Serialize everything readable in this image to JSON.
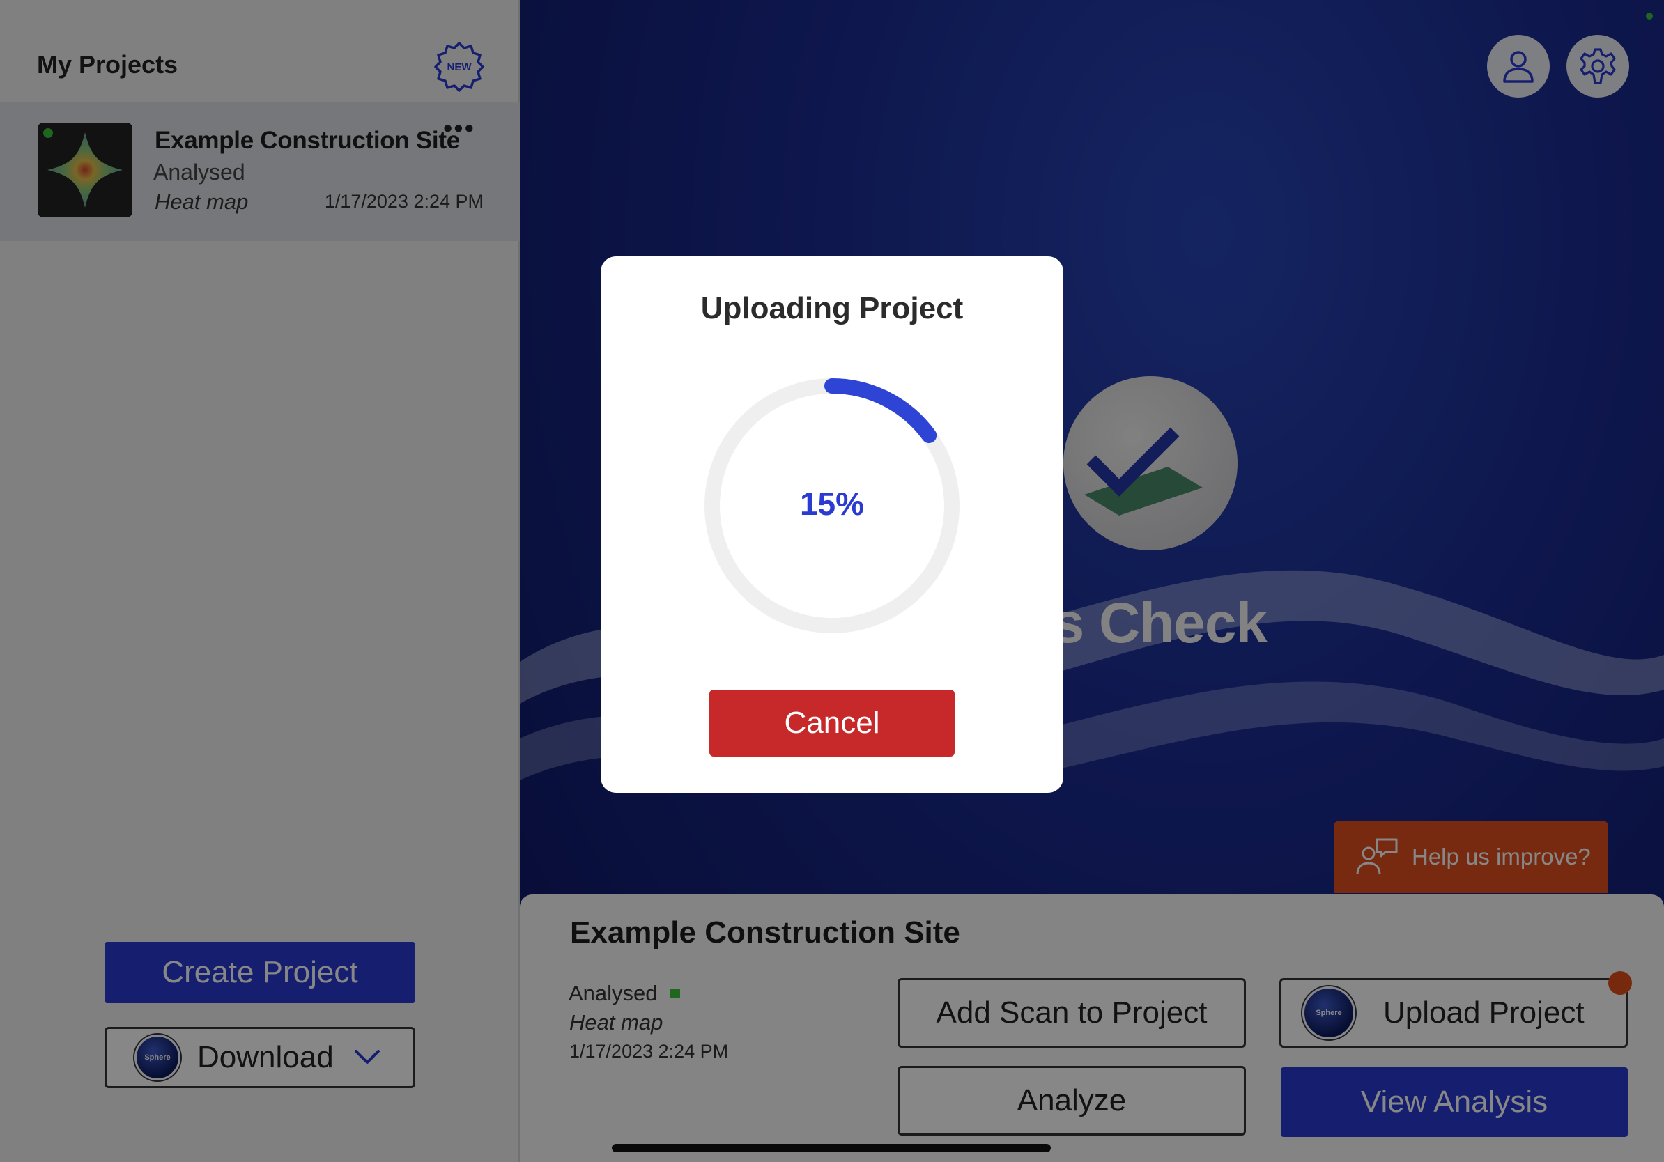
{
  "sidebar": {
    "title": "My Projects",
    "new_badge_text": "NEW",
    "project": {
      "name": "Example Construction Site",
      "status": "Analysed",
      "type": "Heat map",
      "date": "1/17/2023 2:24 PM",
      "more": "•••"
    },
    "create_button": "Create Project",
    "download_button": "Download",
    "download_logo_text": "Sphere"
  },
  "header": {
    "icons": [
      "user-icon",
      "gear-icon"
    ]
  },
  "background": {
    "brand_text": "ss Check"
  },
  "help": {
    "label": "Help us improve?"
  },
  "detail": {
    "title": "Example Construction Site",
    "status": "Analysed",
    "type": "Heat map",
    "date": "1/17/2023 2:24 PM",
    "add_scan_button": "Add Scan to Project",
    "analyze_button": "Analyze",
    "upload_button": "Upload Project",
    "upload_logo_text": "Sphere",
    "view_button": "View Analysis"
  },
  "modal": {
    "title": "Uploading Project",
    "progress_label": "15%",
    "progress_fraction": 0.15,
    "cancel_button": "Cancel"
  },
  "colors": {
    "accent_blue": "#2a3bd2",
    "cancel_red": "#c7282a",
    "help_orange": "#e0501e",
    "status_green": "#3cc13c"
  }
}
